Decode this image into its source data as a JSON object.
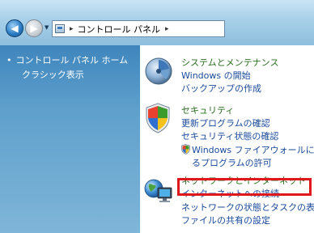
{
  "addressbar": {
    "back_icon": "back-arrow-icon",
    "forward_icon": "forward-arrow-icon",
    "path": [
      "コントロール パネル"
    ],
    "separator": "▸"
  },
  "leftpane": {
    "home_bullet": "•",
    "home_label": "コントロール パネル ホーム",
    "classic_label": "クラシック表示"
  },
  "categories": [
    {
      "title": "システムとメンテナンス",
      "icon": "system-maintenance-icon",
      "links": [
        "Windows の開始",
        "バックアップの作成"
      ]
    },
    {
      "title": "セキュリティ",
      "icon": "security-shield-icon",
      "links": [
        "更新プログラムの確認",
        "セキュリティ状態の確認"
      ],
      "firewall_link_line1": "Windows ファイアウォールによ",
      "firewall_link_line2": "るプログラムの許可"
    },
    {
      "title": "ネットワークとインターネット",
      "icon": "network-internet-icon",
      "links": [
        "インターネットへの接続",
        "ネットワークの状態とタスクの表示",
        "ファイルの共有の設定"
      ]
    }
  ],
  "colors": {
    "category_title": "#2a6f1f",
    "link": "#1a4a9a",
    "highlight": "#e0181e",
    "leftpane_top": "#3f86bd"
  }
}
